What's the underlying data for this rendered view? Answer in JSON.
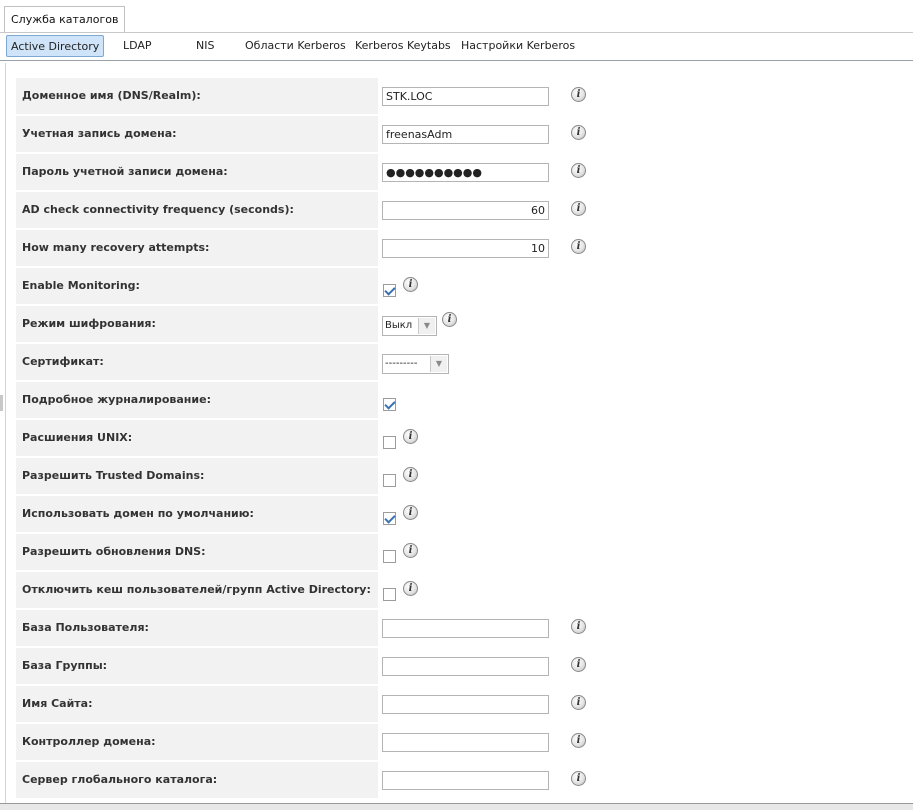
{
  "main_tab": "Служба каталогов",
  "subtabs": [
    {
      "label": "Active Directory",
      "active": true
    },
    {
      "label": "LDAP"
    },
    {
      "label": "NIS"
    },
    {
      "label": "Области Kerberos"
    },
    {
      "label": "Kerberos Keytabs"
    },
    {
      "label": "Настройки Kerberos"
    }
  ],
  "fields": {
    "domain_name": {
      "label": "Доменное имя (DNS/Realm):",
      "value": "STK.LOC"
    },
    "domain_account": {
      "label": "Учетная запись домена:",
      "value": "freenasAdm"
    },
    "domain_password": {
      "label": "Пароль учетной записи домена:",
      "value": "●●●●●●●●●●"
    },
    "ad_check_frequency": {
      "label": "AD check connectivity frequency (seconds):",
      "value": "60"
    },
    "recovery_attempts": {
      "label": "How many recovery attempts:",
      "value": "10"
    },
    "enable_monitoring": {
      "label": "Enable Monitoring:",
      "checked": true
    },
    "encryption_mode": {
      "label": "Режим шифрования:",
      "value": "Выкл"
    },
    "certificate": {
      "label": "Сертификат:",
      "value": "---------"
    },
    "verbose_logging": {
      "label": "Подробное журналирование:",
      "checked": true
    },
    "unix_extensions": {
      "label": "Расшиения UNIX:",
      "checked": false
    },
    "trusted_domains": {
      "label": "Разрешить Trusted Domains:",
      "checked": false
    },
    "default_domain": {
      "label": "Использовать домен по умолчанию:",
      "checked": true
    },
    "dns_updates": {
      "label": "Разрешить обновления DNS:",
      "checked": false
    },
    "disable_cache": {
      "label": "Отключить кеш пользователей/групп Active Directory:",
      "checked": false
    },
    "user_base": {
      "label": "База Пользователя:",
      "value": ""
    },
    "group_base": {
      "label": "База Группы:",
      "value": ""
    },
    "site_name": {
      "label": "Имя Сайта:",
      "value": ""
    },
    "domain_controller": {
      "label": "Контроллер домена:",
      "value": ""
    },
    "global_catalog": {
      "label": "Сервер глобального каталога:",
      "value": ""
    }
  },
  "info_icon_glyph": "i",
  "select_arrow_glyph": "▼"
}
